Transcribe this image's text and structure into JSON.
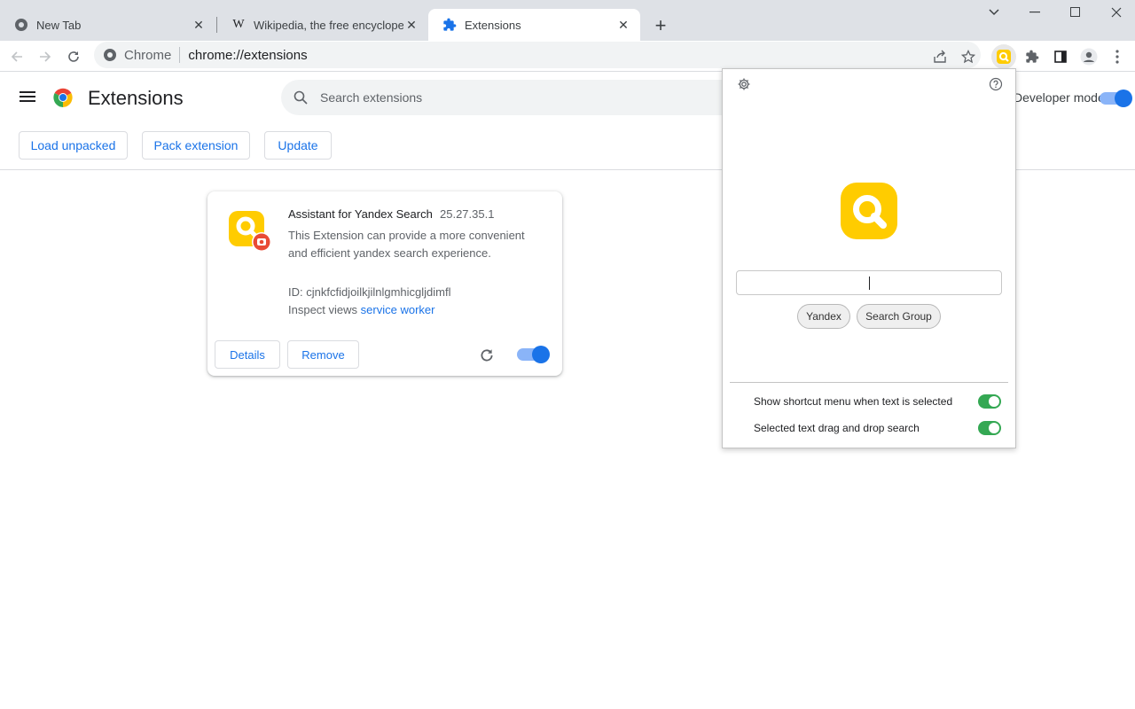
{
  "tabs": [
    {
      "title": "New Tab",
      "icon": "chrome-icon",
      "active": false
    },
    {
      "title": "Wikipedia, the free encyclopedia",
      "icon": "wikipedia-icon",
      "active": false
    },
    {
      "title": "Extensions",
      "icon": "puzzle-icon",
      "active": true
    }
  ],
  "address": {
    "chip": "Chrome",
    "url": "chrome://extensions"
  },
  "header": {
    "title": "Extensions",
    "search_placeholder": "Search extensions",
    "dev_mode_label": "Developer mode",
    "dev_mode_on": true
  },
  "actions": {
    "load_unpacked": "Load unpacked",
    "pack_extension": "Pack extension",
    "update": "Update"
  },
  "extension": {
    "name": "Assistant for Yandex Search",
    "version": "25.27.35.1",
    "description": "This Extension can provide a more convenient and efficient yandex search experience.",
    "id_line": "ID: cjnkfcfidjoilkjilnlgmhicgljdimfl",
    "inspect_label": "Inspect views",
    "inspect_link": "service worker",
    "details_label": "Details",
    "remove_label": "Remove",
    "enabled": true
  },
  "popup": {
    "search_value": "",
    "engines": [
      "Yandex",
      "Search Group"
    ],
    "options": [
      {
        "label": "Show shortcut menu when text is selected",
        "on": true
      },
      {
        "label": "Selected text drag and drop search",
        "on": true
      }
    ]
  },
  "colors": {
    "accent": "#1a73e8",
    "brand_yellow": "#ffcc00",
    "toggle_green": "#34a853"
  }
}
